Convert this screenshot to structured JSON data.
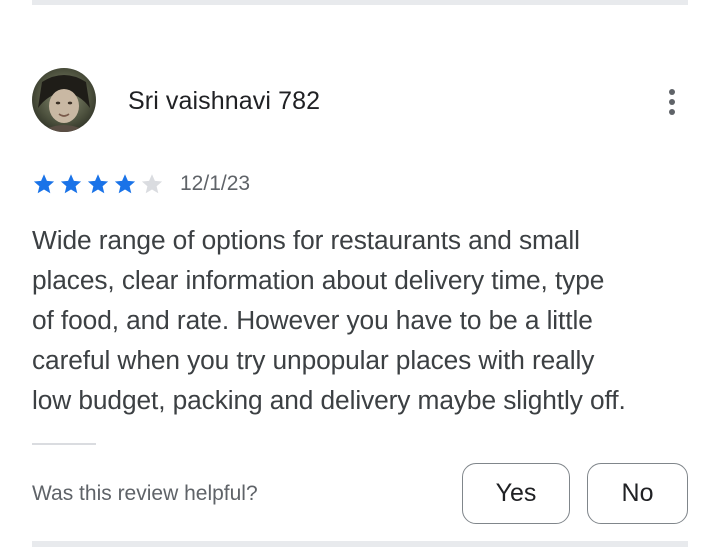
{
  "review": {
    "author": "Sri vaishnavi 782",
    "rating": 4,
    "rating_max": 5,
    "date": "12/1/23",
    "lines": [
      "Wide range of options for restaurants and small",
      "places, clear information about delivery time, type",
      "of food, and rate. However you have to be a little",
      "careful when you try unpopular places with really",
      "low budget, packing and delivery maybe slightly off."
    ]
  },
  "helpful": {
    "question": "Was this review helpful?",
    "yes_label": "Yes",
    "no_label": "No"
  },
  "icons": {
    "more": "more-vert-icon",
    "star_filled": "star-filled-icon",
    "star_empty": "star-empty-icon"
  },
  "colors": {
    "star_filled": "#1a73e8",
    "star_empty": "#dadce0",
    "text_primary": "#202124",
    "text_secondary": "#5f6368",
    "outline": "#80868b"
  }
}
